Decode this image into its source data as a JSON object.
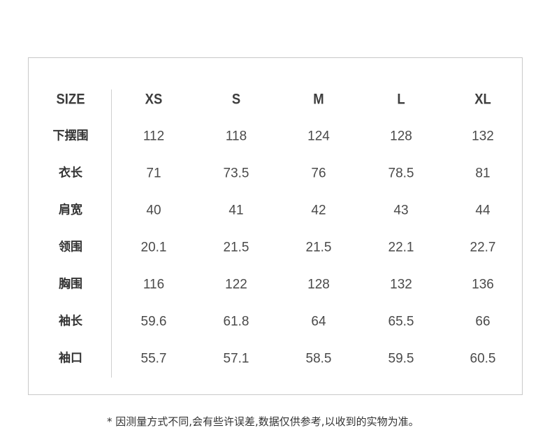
{
  "chart_data": {
    "type": "table",
    "corner_label": "SIZE",
    "columns": [
      "XS",
      "S",
      "M",
      "L",
      "XL"
    ],
    "rows": [
      {
        "label": "下摆围",
        "values": [
          "112",
          "118",
          "124",
          "128",
          "132"
        ]
      },
      {
        "label": "衣长",
        "values": [
          "71",
          "73.5",
          "76",
          "78.5",
          "81"
        ]
      },
      {
        "label": "肩宽",
        "values": [
          "40",
          "41",
          "42",
          "43",
          "44"
        ]
      },
      {
        "label": "领围",
        "values": [
          "20.1",
          "21.5",
          "21.5",
          "22.1",
          "22.7"
        ]
      },
      {
        "label": "胸围",
        "values": [
          "116",
          "122",
          "128",
          "132",
          "136"
        ]
      },
      {
        "label": "袖长",
        "values": [
          "59.6",
          "61.8",
          "64",
          "65.5",
          "66"
        ]
      },
      {
        "label": "袖口",
        "values": [
          "55.7",
          "57.1",
          "58.5",
          "59.5",
          "60.5"
        ]
      }
    ]
  },
  "footnote": "* 因测量方式不同,会有些许误差,数据仅供参考,以收到的实物为准。"
}
